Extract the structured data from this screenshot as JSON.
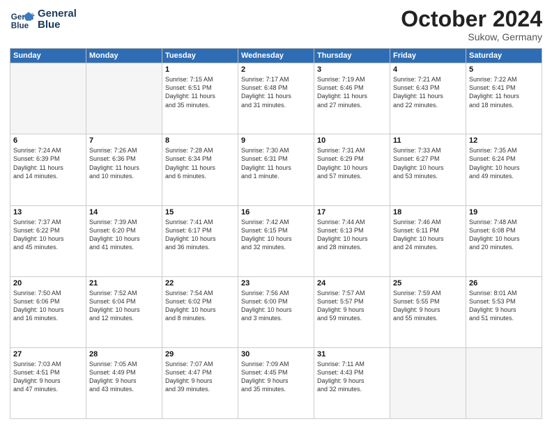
{
  "header": {
    "logo_line1": "General",
    "logo_line2": "Blue",
    "month": "October 2024",
    "location": "Sukow, Germany"
  },
  "days_of_week": [
    "Sunday",
    "Monday",
    "Tuesday",
    "Wednesday",
    "Thursday",
    "Friday",
    "Saturday"
  ],
  "weeks": [
    [
      {
        "day": "",
        "info": ""
      },
      {
        "day": "",
        "info": ""
      },
      {
        "day": "1",
        "info": "Sunrise: 7:15 AM\nSunset: 6:51 PM\nDaylight: 11 hours\nand 35 minutes."
      },
      {
        "day": "2",
        "info": "Sunrise: 7:17 AM\nSunset: 6:48 PM\nDaylight: 11 hours\nand 31 minutes."
      },
      {
        "day": "3",
        "info": "Sunrise: 7:19 AM\nSunset: 6:46 PM\nDaylight: 11 hours\nand 27 minutes."
      },
      {
        "day": "4",
        "info": "Sunrise: 7:21 AM\nSunset: 6:43 PM\nDaylight: 11 hours\nand 22 minutes."
      },
      {
        "day": "5",
        "info": "Sunrise: 7:22 AM\nSunset: 6:41 PM\nDaylight: 11 hours\nand 18 minutes."
      }
    ],
    [
      {
        "day": "6",
        "info": "Sunrise: 7:24 AM\nSunset: 6:39 PM\nDaylight: 11 hours\nand 14 minutes."
      },
      {
        "day": "7",
        "info": "Sunrise: 7:26 AM\nSunset: 6:36 PM\nDaylight: 11 hours\nand 10 minutes."
      },
      {
        "day": "8",
        "info": "Sunrise: 7:28 AM\nSunset: 6:34 PM\nDaylight: 11 hours\nand 6 minutes."
      },
      {
        "day": "9",
        "info": "Sunrise: 7:30 AM\nSunset: 6:31 PM\nDaylight: 11 hours\nand 1 minute."
      },
      {
        "day": "10",
        "info": "Sunrise: 7:31 AM\nSunset: 6:29 PM\nDaylight: 10 hours\nand 57 minutes."
      },
      {
        "day": "11",
        "info": "Sunrise: 7:33 AM\nSunset: 6:27 PM\nDaylight: 10 hours\nand 53 minutes."
      },
      {
        "day": "12",
        "info": "Sunrise: 7:35 AM\nSunset: 6:24 PM\nDaylight: 10 hours\nand 49 minutes."
      }
    ],
    [
      {
        "day": "13",
        "info": "Sunrise: 7:37 AM\nSunset: 6:22 PM\nDaylight: 10 hours\nand 45 minutes."
      },
      {
        "day": "14",
        "info": "Sunrise: 7:39 AM\nSunset: 6:20 PM\nDaylight: 10 hours\nand 41 minutes."
      },
      {
        "day": "15",
        "info": "Sunrise: 7:41 AM\nSunset: 6:17 PM\nDaylight: 10 hours\nand 36 minutes."
      },
      {
        "day": "16",
        "info": "Sunrise: 7:42 AM\nSunset: 6:15 PM\nDaylight: 10 hours\nand 32 minutes."
      },
      {
        "day": "17",
        "info": "Sunrise: 7:44 AM\nSunset: 6:13 PM\nDaylight: 10 hours\nand 28 minutes."
      },
      {
        "day": "18",
        "info": "Sunrise: 7:46 AM\nSunset: 6:11 PM\nDaylight: 10 hours\nand 24 minutes."
      },
      {
        "day": "19",
        "info": "Sunrise: 7:48 AM\nSunset: 6:08 PM\nDaylight: 10 hours\nand 20 minutes."
      }
    ],
    [
      {
        "day": "20",
        "info": "Sunrise: 7:50 AM\nSunset: 6:06 PM\nDaylight: 10 hours\nand 16 minutes."
      },
      {
        "day": "21",
        "info": "Sunrise: 7:52 AM\nSunset: 6:04 PM\nDaylight: 10 hours\nand 12 minutes."
      },
      {
        "day": "22",
        "info": "Sunrise: 7:54 AM\nSunset: 6:02 PM\nDaylight: 10 hours\nand 8 minutes."
      },
      {
        "day": "23",
        "info": "Sunrise: 7:56 AM\nSunset: 6:00 PM\nDaylight: 10 hours\nand 3 minutes."
      },
      {
        "day": "24",
        "info": "Sunrise: 7:57 AM\nSunset: 5:57 PM\nDaylight: 9 hours\nand 59 minutes."
      },
      {
        "day": "25",
        "info": "Sunrise: 7:59 AM\nSunset: 5:55 PM\nDaylight: 9 hours\nand 55 minutes."
      },
      {
        "day": "26",
        "info": "Sunrise: 8:01 AM\nSunset: 5:53 PM\nDaylight: 9 hours\nand 51 minutes."
      }
    ],
    [
      {
        "day": "27",
        "info": "Sunrise: 7:03 AM\nSunset: 4:51 PM\nDaylight: 9 hours\nand 47 minutes."
      },
      {
        "day": "28",
        "info": "Sunrise: 7:05 AM\nSunset: 4:49 PM\nDaylight: 9 hours\nand 43 minutes."
      },
      {
        "day": "29",
        "info": "Sunrise: 7:07 AM\nSunset: 4:47 PM\nDaylight: 9 hours\nand 39 minutes."
      },
      {
        "day": "30",
        "info": "Sunrise: 7:09 AM\nSunset: 4:45 PM\nDaylight: 9 hours\nand 35 minutes."
      },
      {
        "day": "31",
        "info": "Sunrise: 7:11 AM\nSunset: 4:43 PM\nDaylight: 9 hours\nand 32 minutes."
      },
      {
        "day": "",
        "info": ""
      },
      {
        "day": "",
        "info": ""
      }
    ]
  ]
}
